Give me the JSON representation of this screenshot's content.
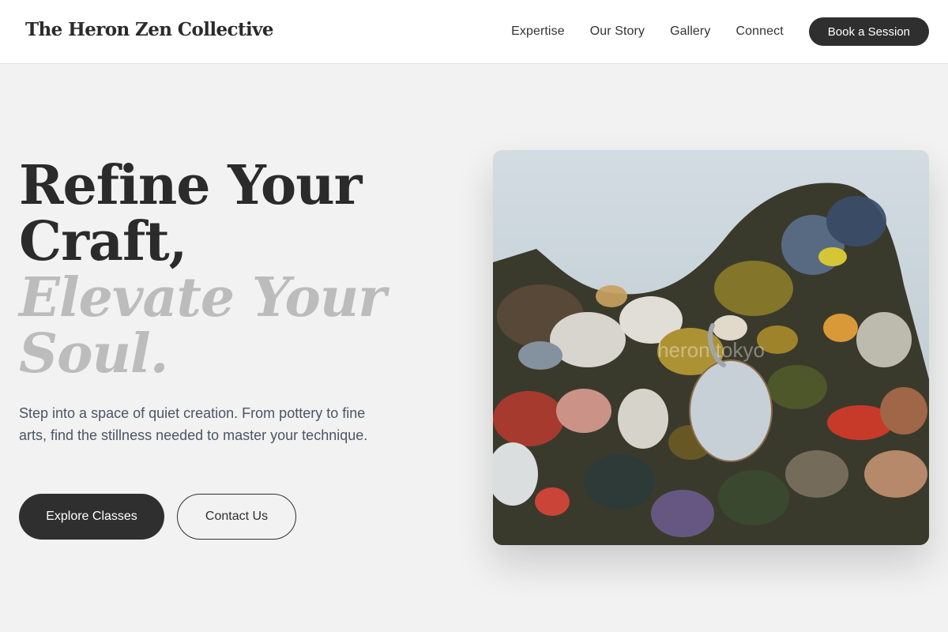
{
  "header": {
    "logo": "The Heron Zen Collective",
    "nav": [
      "Expertise",
      "Our Story",
      "Gallery",
      "Connect"
    ],
    "cta": "Book a Session"
  },
  "hero": {
    "title_line1": "Refine Your",
    "title_line2": "Craft,",
    "title_line3": "Elevate Your",
    "title_line4": "Soul.",
    "subtitle": "Step into a space of quiet creation. From pottery to fine arts, find the stillness needed to master your technique.",
    "primary_button": "Explore Classes",
    "secondary_button": "Contact Us",
    "image": {
      "subject": "paint-palette-photo",
      "watermark": "heron tokyo"
    }
  },
  "colors": {
    "background": "#f2f2f2",
    "header": "#ffffff",
    "dark_button": "#2f2f2f",
    "title": "#2b2b2b",
    "title_muted": "#bcbcbc",
    "body_text": "#4a5566"
  }
}
